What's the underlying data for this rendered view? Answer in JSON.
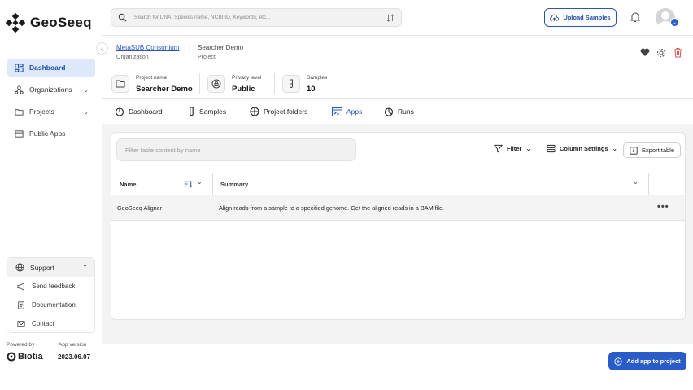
{
  "app": {
    "brand": "GeoSeeq"
  },
  "search": {
    "placeholder": "Search for DNA, Species name, NCBI ID, Keywords, etc..."
  },
  "header": {
    "upload_label": "Upload Samples"
  },
  "sidebar": {
    "items": [
      {
        "label": "Dashboard",
        "active": true
      },
      {
        "label": "Organizations"
      },
      {
        "label": "Projects"
      },
      {
        "label": "Public Apps"
      }
    ],
    "support": {
      "label": "Support",
      "links": [
        {
          "label": "Send feedback"
        },
        {
          "label": "Documentation"
        },
        {
          "label": "Contact"
        }
      ]
    },
    "footer": {
      "powered_by": "Powered by",
      "company": "Biotia",
      "app_version_label": "App version",
      "app_version": "2023.06.07"
    }
  },
  "breadcrumb": {
    "org_name": "MetaSUB Consortium",
    "org_label": "Organization",
    "project_name": "Searcher Demo",
    "project_label": "Project"
  },
  "info": {
    "project_name_label": "Project name",
    "project_name": "Searcher Demo",
    "privacy_label": "Privacy level",
    "privacy": "Public",
    "samples_label": "Samples",
    "samples": "10"
  },
  "tabs": [
    {
      "label": "Dashboard"
    },
    {
      "label": "Samples"
    },
    {
      "label": "Project folders"
    },
    {
      "label": "Apps",
      "active": true
    },
    {
      "label": "Runs"
    }
  ],
  "table": {
    "filter_placeholder": "Filter table content by name",
    "filter_label": "Filter",
    "column_settings_label": "Column Settings",
    "export_label": "Export table",
    "columns": [
      "Name",
      "Summary"
    ],
    "rows": [
      {
        "name": "GeoSeeq Aligner",
        "summary": "Align reads from a sample to a specified genome. Get the aligned reads in a BAM file."
      }
    ]
  },
  "actions": {
    "add_app_label": "Add app to project"
  },
  "colors": {
    "accent": "#2a5cc8",
    "active_bg": "#dde8fb",
    "danger": "#d9534f"
  }
}
